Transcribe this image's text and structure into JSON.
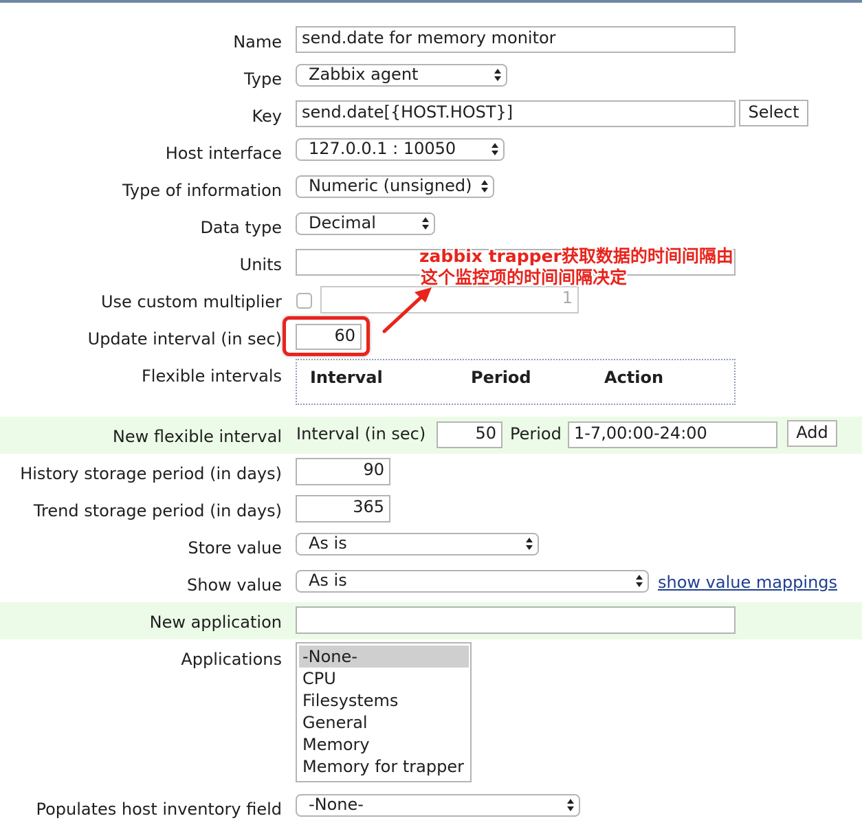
{
  "form": {
    "name": {
      "label": "Name",
      "value": "send.date for memory monitor"
    },
    "type": {
      "label": "Type",
      "value": "Zabbix agent"
    },
    "key": {
      "label": "Key",
      "value": "send.date[{HOST.HOST}]",
      "select_button": "Select"
    },
    "host_interface": {
      "label": "Host interface",
      "value": "127.0.0.1 : 10050"
    },
    "type_of_information": {
      "label": "Type of information",
      "value": "Numeric (unsigned)"
    },
    "data_type": {
      "label": "Data type",
      "value": "Decimal"
    },
    "units": {
      "label": "Units",
      "value": ""
    },
    "custom_multiplier": {
      "label": "Use custom multiplier",
      "checked": false,
      "value": "1"
    },
    "update_interval": {
      "label": "Update interval (in sec)",
      "value": "60"
    },
    "flexible_intervals": {
      "label": "Flexible intervals",
      "columns": [
        "Interval",
        "Period",
        "Action"
      ]
    },
    "new_flexible_interval": {
      "label": "New flexible interval",
      "interval_label": "Interval (in sec)",
      "interval_value": "50",
      "period_label": "Period",
      "period_value": "1-7,00:00-24:00",
      "add_button": "Add"
    },
    "history": {
      "label": "History storage period (in days)",
      "value": "90"
    },
    "trend": {
      "label": "Trend storage period (in days)",
      "value": "365"
    },
    "store_value": {
      "label": "Store value",
      "value": "As is"
    },
    "show_value": {
      "label": "Show value",
      "value": "As is",
      "mappings_link": "show value mappings"
    },
    "new_application": {
      "label": "New application",
      "value": ""
    },
    "applications": {
      "label": "Applications",
      "options": [
        "-None-",
        "CPU",
        "Filesystems",
        "General",
        "Memory",
        "Memory for trapper"
      ],
      "selected": "-None-"
    },
    "inventory": {
      "label": "Populates host inventory field",
      "value": "-None-"
    }
  },
  "annotation": {
    "line1": "zabbix trapper获取数据的时间间隔由",
    "line2": "这个监控项的时间间隔决定",
    "color": "#e8241c"
  }
}
